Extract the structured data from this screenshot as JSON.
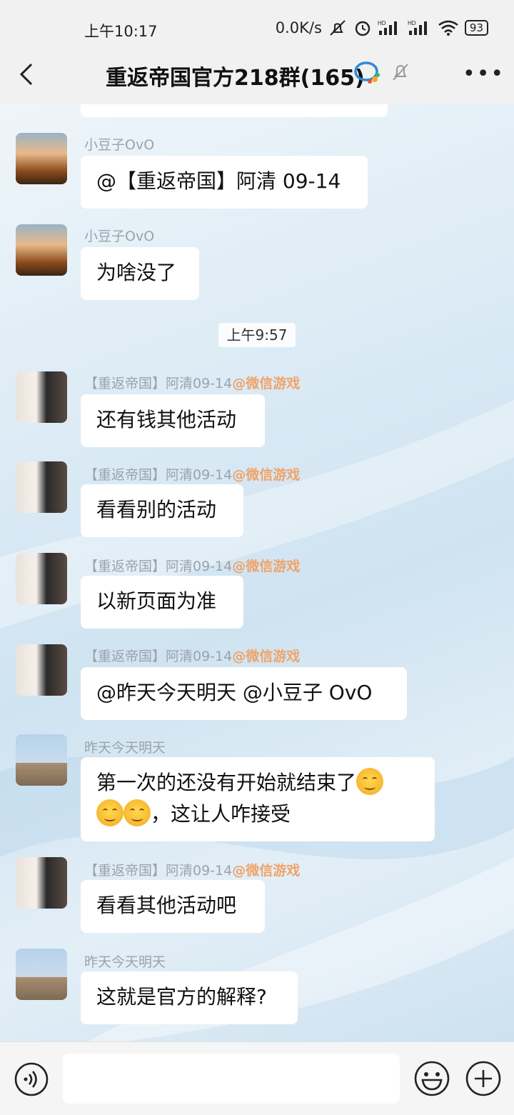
{
  "status_bar": {
    "time": "上午10:17",
    "speed": "0.0K/s",
    "battery": "93"
  },
  "header": {
    "title": "重返帝国官方218群(165)"
  },
  "timestamp": "上午9:57",
  "messages": [
    {
      "sender": "小豆子OvO",
      "text": "@【重返帝国】阿清 09-14"
    },
    {
      "sender": "小豆子OvO",
      "text": "为啥没了"
    },
    {
      "sender": "【重返帝国】阿清09-14",
      "tag": "@微信游戏",
      "text": "还有钱其他活动"
    },
    {
      "sender": "【重返帝国】阿清09-14",
      "tag": "@微信游戏",
      "text": "看看别的活动"
    },
    {
      "sender": "【重返帝国】阿清09-14",
      "tag": "@微信游戏",
      "text": "以新页面为准"
    },
    {
      "sender": "【重返帝国】阿清09-14",
      "tag": "@微信游戏",
      "text": "@昨天今天明天 @小豆子 OvO"
    },
    {
      "sender": "昨天今天明天",
      "text_line1": "第一次的还没有开始就结束了",
      "text_line2": "，这让人咋接受"
    },
    {
      "sender": "【重返帝国】阿清09-14",
      "tag": "@微信游戏",
      "text": "看看其他活动吧"
    },
    {
      "sender": "昨天今天明天",
      "text": "这就是官方的解释?"
    }
  ],
  "colors": {
    "header_bg": "#f1f1f1",
    "bubble_bg": "#ffffff",
    "sender_name": "#9aa3ab",
    "wechat_tag": "#f0a36a"
  },
  "icons": [
    "back-arrow-icon",
    "wecom-icon",
    "mute-bell-icon",
    "more-icon",
    "voice-icon",
    "emoji-icon",
    "plus-icon"
  ]
}
